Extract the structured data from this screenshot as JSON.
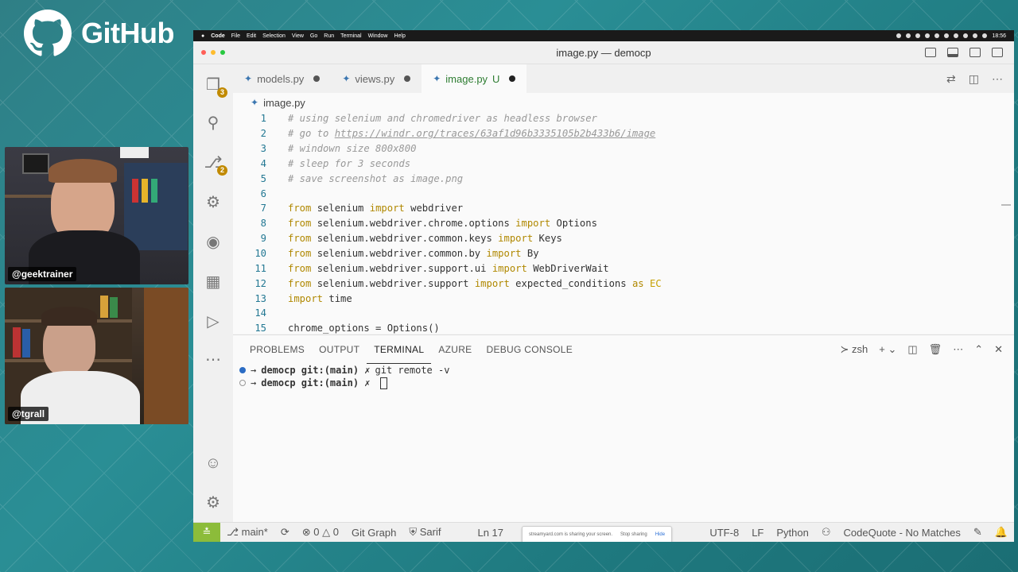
{
  "brand": {
    "name": "GitHub"
  },
  "cams": [
    {
      "label": "@geektrainer"
    },
    {
      "label": "@tgrall"
    }
  ],
  "macmenu": {
    "app": "Code",
    "items": [
      "File",
      "Edit",
      "Selection",
      "View",
      "Go",
      "Run",
      "Terminal",
      "Window",
      "Help"
    ],
    "clock": "18:56"
  },
  "window": {
    "title": "image.py — democp"
  },
  "activity": {
    "explorer_badge": "3",
    "scm_badge": "2"
  },
  "tabs": [
    {
      "label": "models.py",
      "status": ""
    },
    {
      "label": "views.py",
      "status": ""
    },
    {
      "label": "image.py",
      "status": "U"
    }
  ],
  "breadcrumb": "image.py",
  "code": {
    "numbers": [
      "1",
      "2",
      "3",
      "4",
      "5",
      "6",
      "7",
      "8",
      "9",
      "10",
      "11",
      "12",
      "13",
      "14",
      "15"
    ],
    "comments": {
      "l1": "# using selenium and chromedriver as headless browser",
      "l2_prefix": "# go to ",
      "l2_url": "https://windr.org/traces/63af1d96b3335105b2b433b6/image",
      "l3": "# windown size 800x800",
      "l4": "# sleep for 3 seconds",
      "l5": "# save screenshot as image.png"
    },
    "tokens": {
      "from": "from",
      "import": "import",
      "as": "as"
    },
    "l7": {
      "mod": " selenium ",
      "name": " webdriver"
    },
    "l8": {
      "mod": " selenium.webdriver.chrome.options ",
      "name": " Options"
    },
    "l9": {
      "mod": " selenium.webdriver.common.keys ",
      "name": " Keys"
    },
    "l10": {
      "mod": " selenium.webdriver.common.by ",
      "name": " By"
    },
    "l11": {
      "mod": " selenium.webdriver.support.ui ",
      "name": " WebDriverWait"
    },
    "l12": {
      "mod": " selenium.webdriver.support ",
      "name": " expected_conditions ",
      "alias": " EC"
    },
    "l13": {
      "name": " time"
    },
    "l15": "chrome_options = Options()"
  },
  "panel": {
    "tabs": [
      "PROBLEMS",
      "OUTPUT",
      "TERMINAL",
      "AZURE",
      "DEBUG CONSOLE"
    ],
    "shell": "zsh",
    "lines": [
      {
        "prompt": "democp git:(main) ✗",
        "cmd": "git remote -v"
      },
      {
        "prompt": "democp git:(main) ✗",
        "cmd": ""
      }
    ]
  },
  "status": {
    "branch": "main*",
    "errors": "0",
    "warnings": "0",
    "gitgraph": "Git Graph",
    "sarif": "Sarif",
    "position": "Ln 17",
    "share_text": "streamyard.com is sharing your screen.",
    "stop_sharing": "Stop sharing",
    "hide": "Hide",
    "encoding": "UTF-8",
    "eol": "LF",
    "language": "Python",
    "codequote": "CodeQuote - No Matches"
  },
  "colors": {
    "accent_green": "#2e7d32",
    "remote": "#8cbc3a",
    "badge": "#c18a00"
  }
}
